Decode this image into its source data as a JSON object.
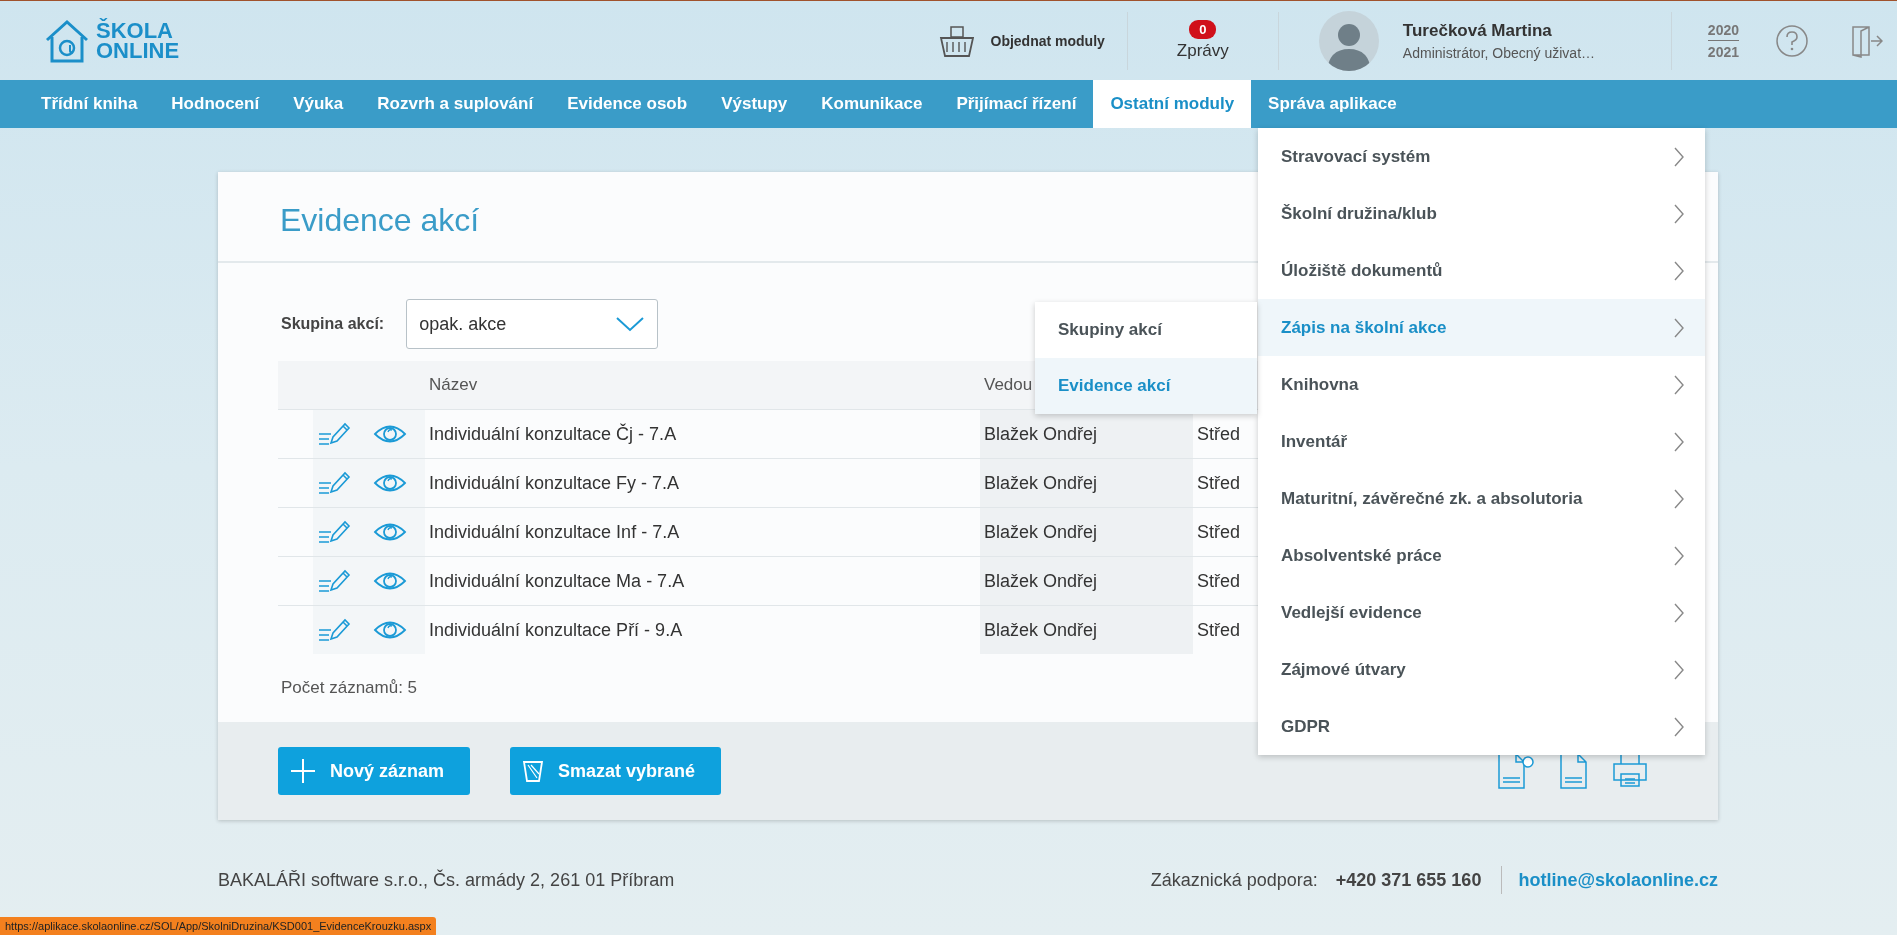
{
  "logo": {
    "line1": "ŠKOLA",
    "line2": "ONLINE"
  },
  "header": {
    "order_modules": "Objednat moduly",
    "messages": {
      "count": "0",
      "label": "Zprávy"
    },
    "user": {
      "name": "Turečková Martina",
      "role": "Administrátor, Obecný uživat…"
    },
    "school_year": {
      "from": "2020",
      "to": "2021"
    }
  },
  "nav": [
    {
      "label": "Třídní kniha",
      "selected": false
    },
    {
      "label": "Hodnocení",
      "selected": false
    },
    {
      "label": "Výuka",
      "selected": false
    },
    {
      "label": "Rozvrh a suplování",
      "selected": false
    },
    {
      "label": "Evidence osob",
      "selected": false
    },
    {
      "label": "Výstupy",
      "selected": false
    },
    {
      "label": "Komunikace",
      "selected": false
    },
    {
      "label": "Přijímací řízení",
      "selected": false
    },
    {
      "label": "Ostatní moduly",
      "selected": true
    },
    {
      "label": "Správa aplikace",
      "selected": false
    }
  ],
  "page": {
    "title": "Evidence akcí",
    "filter": {
      "label": "Skupina akcí:",
      "value": "opak. akce"
    },
    "table": {
      "columns": [
        "Název",
        "Vedou"
      ],
      "rows": [
        {
          "name": "Individuální konzultace Čj - 7.A",
          "leader": "Blažek Ondřej",
          "column_3": "Střed"
        },
        {
          "name": "Individuální konzultace Fy - 7.A",
          "leader": "Blažek Ondřej",
          "column_3": "Střed"
        },
        {
          "name": "Individuální konzultace Inf - 7.A",
          "leader": "Blažek Ondřej",
          "column_3": "Střed"
        },
        {
          "name": "Individuální konzultace Ma - 7.A",
          "leader": "Blažek Ondřej",
          "column_3": "Střed"
        },
        {
          "name": "Individuální konzultace Pří - 9.A",
          "leader": "Blažek Ondřej",
          "column_3": "Střed"
        }
      ]
    },
    "record_count": "Počet záznamů: 5",
    "buttons": [
      {
        "kind": "add",
        "label": "Nový záznam"
      },
      {
        "kind": "delete",
        "label": "Smazat vybrané"
      }
    ]
  },
  "menu": {
    "items": [
      {
        "label": "Stravovací systém",
        "selected": false
      },
      {
        "label": "Školní družina/klub",
        "selected": false
      },
      {
        "label": "Úložiště dokumentů",
        "selected": false
      },
      {
        "label": "Zápis na školní akce",
        "selected": true
      },
      {
        "label": "Knihovna",
        "selected": false
      },
      {
        "label": "Inventář",
        "selected": false
      },
      {
        "label": "Maturitní, závěrečné zk. a absolutoria",
        "selected": false
      },
      {
        "label": "Absolventské práce",
        "selected": false
      },
      {
        "label": "Vedlejší evidence",
        "selected": false
      },
      {
        "label": "Zájmové útvary",
        "selected": false
      },
      {
        "label": "GDPR",
        "selected": false
      }
    ]
  },
  "submenu": {
    "items": [
      {
        "label": "Skupiny akcí",
        "selected": false
      },
      {
        "label": "Evidence akcí",
        "selected": true
      }
    ]
  },
  "footer": {
    "company": "BAKALÁŘI software s.r.o., Čs. armády 2, 261 01 Příbram",
    "support_label": "Zákaznická podpora:",
    "phone": "+420 371 655 160",
    "email": "hotline@skolaonline.cz"
  },
  "status_bar": {
    "url": "https://aplikace.skolaonline.cz/SOL/App/SkolniDruzina/KSD001_EvidenceKrouzku.aspx"
  }
}
